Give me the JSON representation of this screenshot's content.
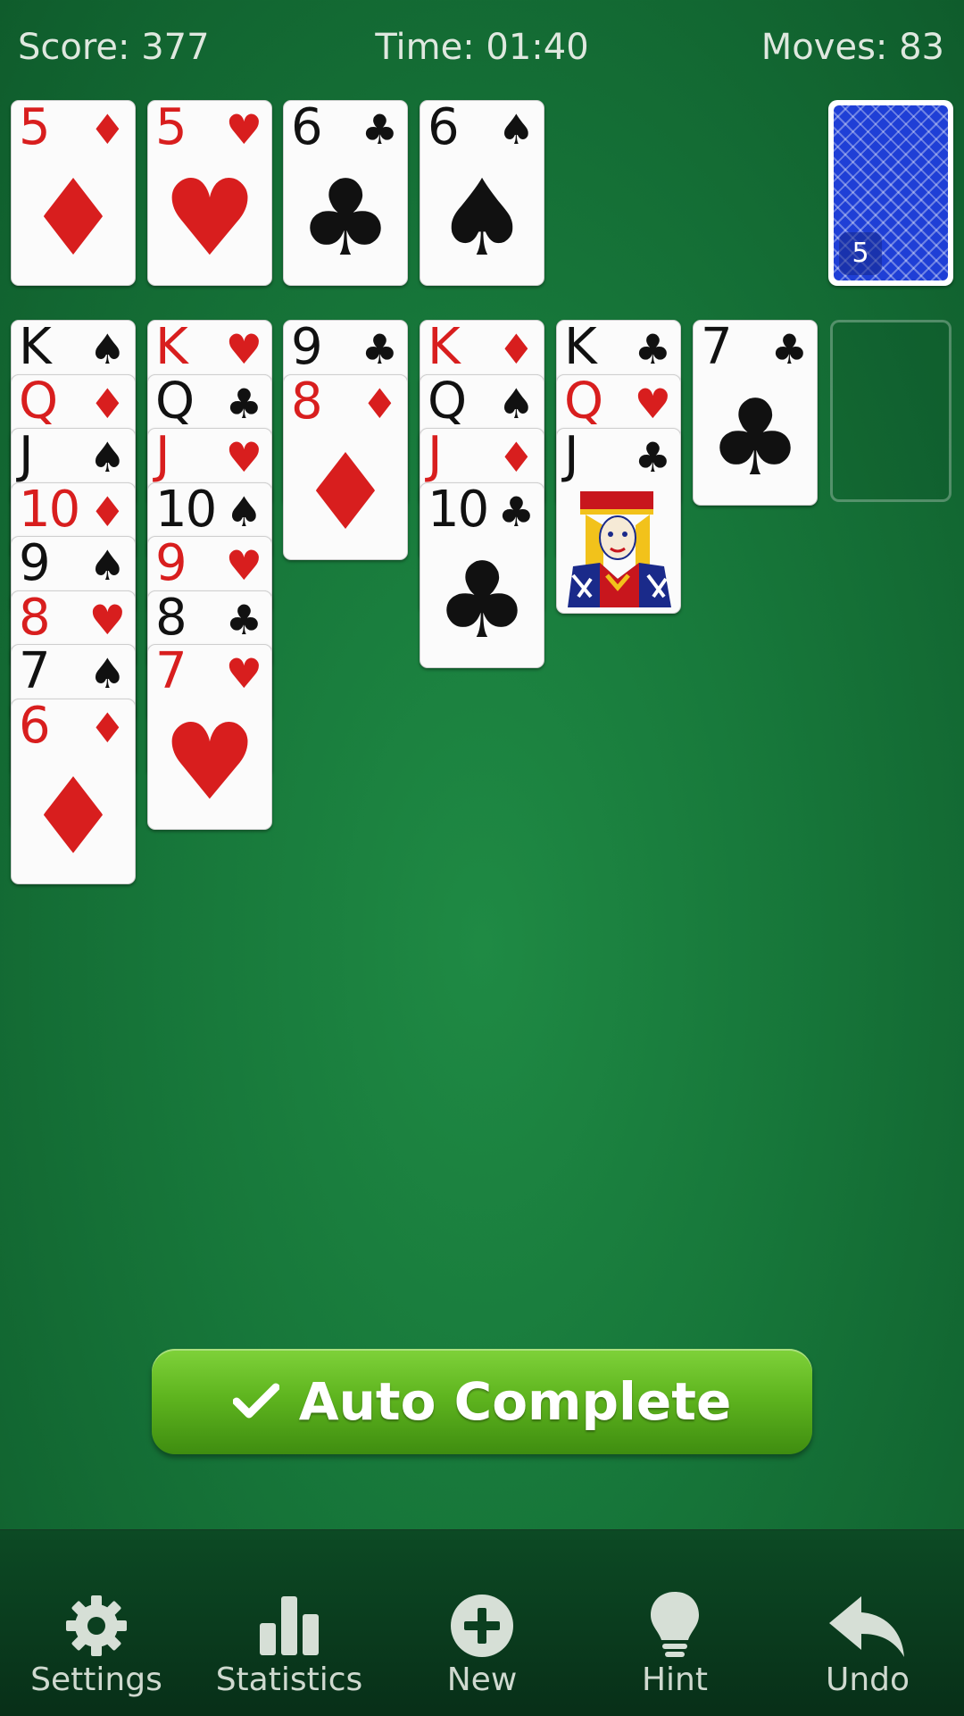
{
  "hud": {
    "score": "Score: 377",
    "time": "Time: 01:40",
    "moves": "Moves: 83"
  },
  "stock": {
    "count": "5"
  },
  "foundations": [
    {
      "rank": "5",
      "suit": "♦",
      "color": "red"
    },
    {
      "rank": "5",
      "suit": "♥",
      "color": "red"
    },
    {
      "rank": "6",
      "suit": "♣",
      "color": "black"
    },
    {
      "rank": "6",
      "suit": "♠",
      "color": "black"
    }
  ],
  "tableau": [
    [
      {
        "rank": "K",
        "suit": "♠",
        "color": "black"
      },
      {
        "rank": "Q",
        "suit": "♦",
        "color": "red"
      },
      {
        "rank": "J",
        "suit": "♠",
        "color": "black"
      },
      {
        "rank": "10",
        "suit": "♦",
        "color": "red"
      },
      {
        "rank": "9",
        "suit": "♠",
        "color": "black"
      },
      {
        "rank": "8",
        "suit": "♥",
        "color": "red"
      },
      {
        "rank": "7",
        "suit": "♠",
        "color": "black"
      },
      {
        "rank": "6",
        "suit": "♦",
        "color": "red"
      }
    ],
    [
      {
        "rank": "K",
        "suit": "♥",
        "color": "red"
      },
      {
        "rank": "Q",
        "suit": "♣",
        "color": "black"
      },
      {
        "rank": "J",
        "suit": "♥",
        "color": "red"
      },
      {
        "rank": "10",
        "suit": "♠",
        "color": "black"
      },
      {
        "rank": "9",
        "suit": "♥",
        "color": "red"
      },
      {
        "rank": "8",
        "suit": "♣",
        "color": "black"
      },
      {
        "rank": "7",
        "suit": "♥",
        "color": "red"
      }
    ],
    [
      {
        "rank": "9",
        "suit": "♣",
        "color": "black"
      },
      {
        "rank": "8",
        "suit": "♦",
        "color": "red"
      }
    ],
    [
      {
        "rank": "K",
        "suit": "♦",
        "color": "red"
      },
      {
        "rank": "Q",
        "suit": "♠",
        "color": "black"
      },
      {
        "rank": "J",
        "suit": "♦",
        "color": "red"
      },
      {
        "rank": "10",
        "suit": "♣",
        "color": "black"
      }
    ],
    [
      {
        "rank": "K",
        "suit": "♣",
        "color": "black"
      },
      {
        "rank": "Q",
        "suit": "♥",
        "color": "red"
      },
      {
        "rank": "J",
        "suit": "♣",
        "color": "black",
        "face": true
      }
    ],
    [
      {
        "rank": "7",
        "suit": "♣",
        "color": "black"
      }
    ]
  ],
  "auto_complete": {
    "label": "Auto Complete"
  },
  "nav": [
    {
      "label": "Settings",
      "icon": "gear-icon"
    },
    {
      "label": "Statistics",
      "icon": "bar-chart-icon"
    },
    {
      "label": "New",
      "icon": "plus-circle-icon"
    },
    {
      "label": "Hint",
      "icon": "lightbulb-icon"
    },
    {
      "label": "Undo",
      "icon": "undo-arrow-icon"
    }
  ],
  "colors": {
    "felt": "#17773a",
    "red": "#d81e1e",
    "black": "#111111",
    "button": "#5fb51f",
    "stock_back": "#1f3fd6"
  }
}
